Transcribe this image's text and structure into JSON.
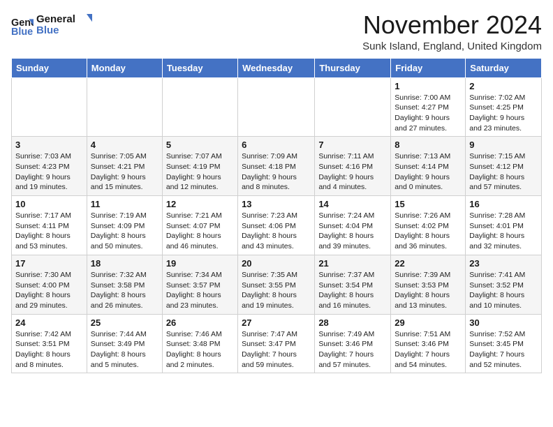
{
  "header": {
    "logo_line1": "General",
    "logo_line2": "Blue",
    "month": "November 2024",
    "location": "Sunk Island, England, United Kingdom"
  },
  "weekdays": [
    "Sunday",
    "Monday",
    "Tuesday",
    "Wednesday",
    "Thursday",
    "Friday",
    "Saturday"
  ],
  "rows": [
    [
      {
        "day": "",
        "info": ""
      },
      {
        "day": "",
        "info": ""
      },
      {
        "day": "",
        "info": ""
      },
      {
        "day": "",
        "info": ""
      },
      {
        "day": "",
        "info": ""
      },
      {
        "day": "1",
        "info": "Sunrise: 7:00 AM\nSunset: 4:27 PM\nDaylight: 9 hours\nand 27 minutes."
      },
      {
        "day": "2",
        "info": "Sunrise: 7:02 AM\nSunset: 4:25 PM\nDaylight: 9 hours\nand 23 minutes."
      }
    ],
    [
      {
        "day": "3",
        "info": "Sunrise: 7:03 AM\nSunset: 4:23 PM\nDaylight: 9 hours\nand 19 minutes."
      },
      {
        "day": "4",
        "info": "Sunrise: 7:05 AM\nSunset: 4:21 PM\nDaylight: 9 hours\nand 15 minutes."
      },
      {
        "day": "5",
        "info": "Sunrise: 7:07 AM\nSunset: 4:19 PM\nDaylight: 9 hours\nand 12 minutes."
      },
      {
        "day": "6",
        "info": "Sunrise: 7:09 AM\nSunset: 4:18 PM\nDaylight: 9 hours\nand 8 minutes."
      },
      {
        "day": "7",
        "info": "Sunrise: 7:11 AM\nSunset: 4:16 PM\nDaylight: 9 hours\nand 4 minutes."
      },
      {
        "day": "8",
        "info": "Sunrise: 7:13 AM\nSunset: 4:14 PM\nDaylight: 9 hours\nand 0 minutes."
      },
      {
        "day": "9",
        "info": "Sunrise: 7:15 AM\nSunset: 4:12 PM\nDaylight: 8 hours\nand 57 minutes."
      }
    ],
    [
      {
        "day": "10",
        "info": "Sunrise: 7:17 AM\nSunset: 4:11 PM\nDaylight: 8 hours\nand 53 minutes."
      },
      {
        "day": "11",
        "info": "Sunrise: 7:19 AM\nSunset: 4:09 PM\nDaylight: 8 hours\nand 50 minutes."
      },
      {
        "day": "12",
        "info": "Sunrise: 7:21 AM\nSunset: 4:07 PM\nDaylight: 8 hours\nand 46 minutes."
      },
      {
        "day": "13",
        "info": "Sunrise: 7:23 AM\nSunset: 4:06 PM\nDaylight: 8 hours\nand 43 minutes."
      },
      {
        "day": "14",
        "info": "Sunrise: 7:24 AM\nSunset: 4:04 PM\nDaylight: 8 hours\nand 39 minutes."
      },
      {
        "day": "15",
        "info": "Sunrise: 7:26 AM\nSunset: 4:02 PM\nDaylight: 8 hours\nand 36 minutes."
      },
      {
        "day": "16",
        "info": "Sunrise: 7:28 AM\nSunset: 4:01 PM\nDaylight: 8 hours\nand 32 minutes."
      }
    ],
    [
      {
        "day": "17",
        "info": "Sunrise: 7:30 AM\nSunset: 4:00 PM\nDaylight: 8 hours\nand 29 minutes."
      },
      {
        "day": "18",
        "info": "Sunrise: 7:32 AM\nSunset: 3:58 PM\nDaylight: 8 hours\nand 26 minutes."
      },
      {
        "day": "19",
        "info": "Sunrise: 7:34 AM\nSunset: 3:57 PM\nDaylight: 8 hours\nand 23 minutes."
      },
      {
        "day": "20",
        "info": "Sunrise: 7:35 AM\nSunset: 3:55 PM\nDaylight: 8 hours\nand 19 minutes."
      },
      {
        "day": "21",
        "info": "Sunrise: 7:37 AM\nSunset: 3:54 PM\nDaylight: 8 hours\nand 16 minutes."
      },
      {
        "day": "22",
        "info": "Sunrise: 7:39 AM\nSunset: 3:53 PM\nDaylight: 8 hours\nand 13 minutes."
      },
      {
        "day": "23",
        "info": "Sunrise: 7:41 AM\nSunset: 3:52 PM\nDaylight: 8 hours\nand 10 minutes."
      }
    ],
    [
      {
        "day": "24",
        "info": "Sunrise: 7:42 AM\nSunset: 3:51 PM\nDaylight: 8 hours\nand 8 minutes."
      },
      {
        "day": "25",
        "info": "Sunrise: 7:44 AM\nSunset: 3:49 PM\nDaylight: 8 hours\nand 5 minutes."
      },
      {
        "day": "26",
        "info": "Sunrise: 7:46 AM\nSunset: 3:48 PM\nDaylight: 8 hours\nand 2 minutes."
      },
      {
        "day": "27",
        "info": "Sunrise: 7:47 AM\nSunset: 3:47 PM\nDaylight: 7 hours\nand 59 minutes."
      },
      {
        "day": "28",
        "info": "Sunrise: 7:49 AM\nSunset: 3:46 PM\nDaylight: 7 hours\nand 57 minutes."
      },
      {
        "day": "29",
        "info": "Sunrise: 7:51 AM\nSunset: 3:46 PM\nDaylight: 7 hours\nand 54 minutes."
      },
      {
        "day": "30",
        "info": "Sunrise: 7:52 AM\nSunset: 3:45 PM\nDaylight: 7 hours\nand 52 minutes."
      }
    ]
  ]
}
